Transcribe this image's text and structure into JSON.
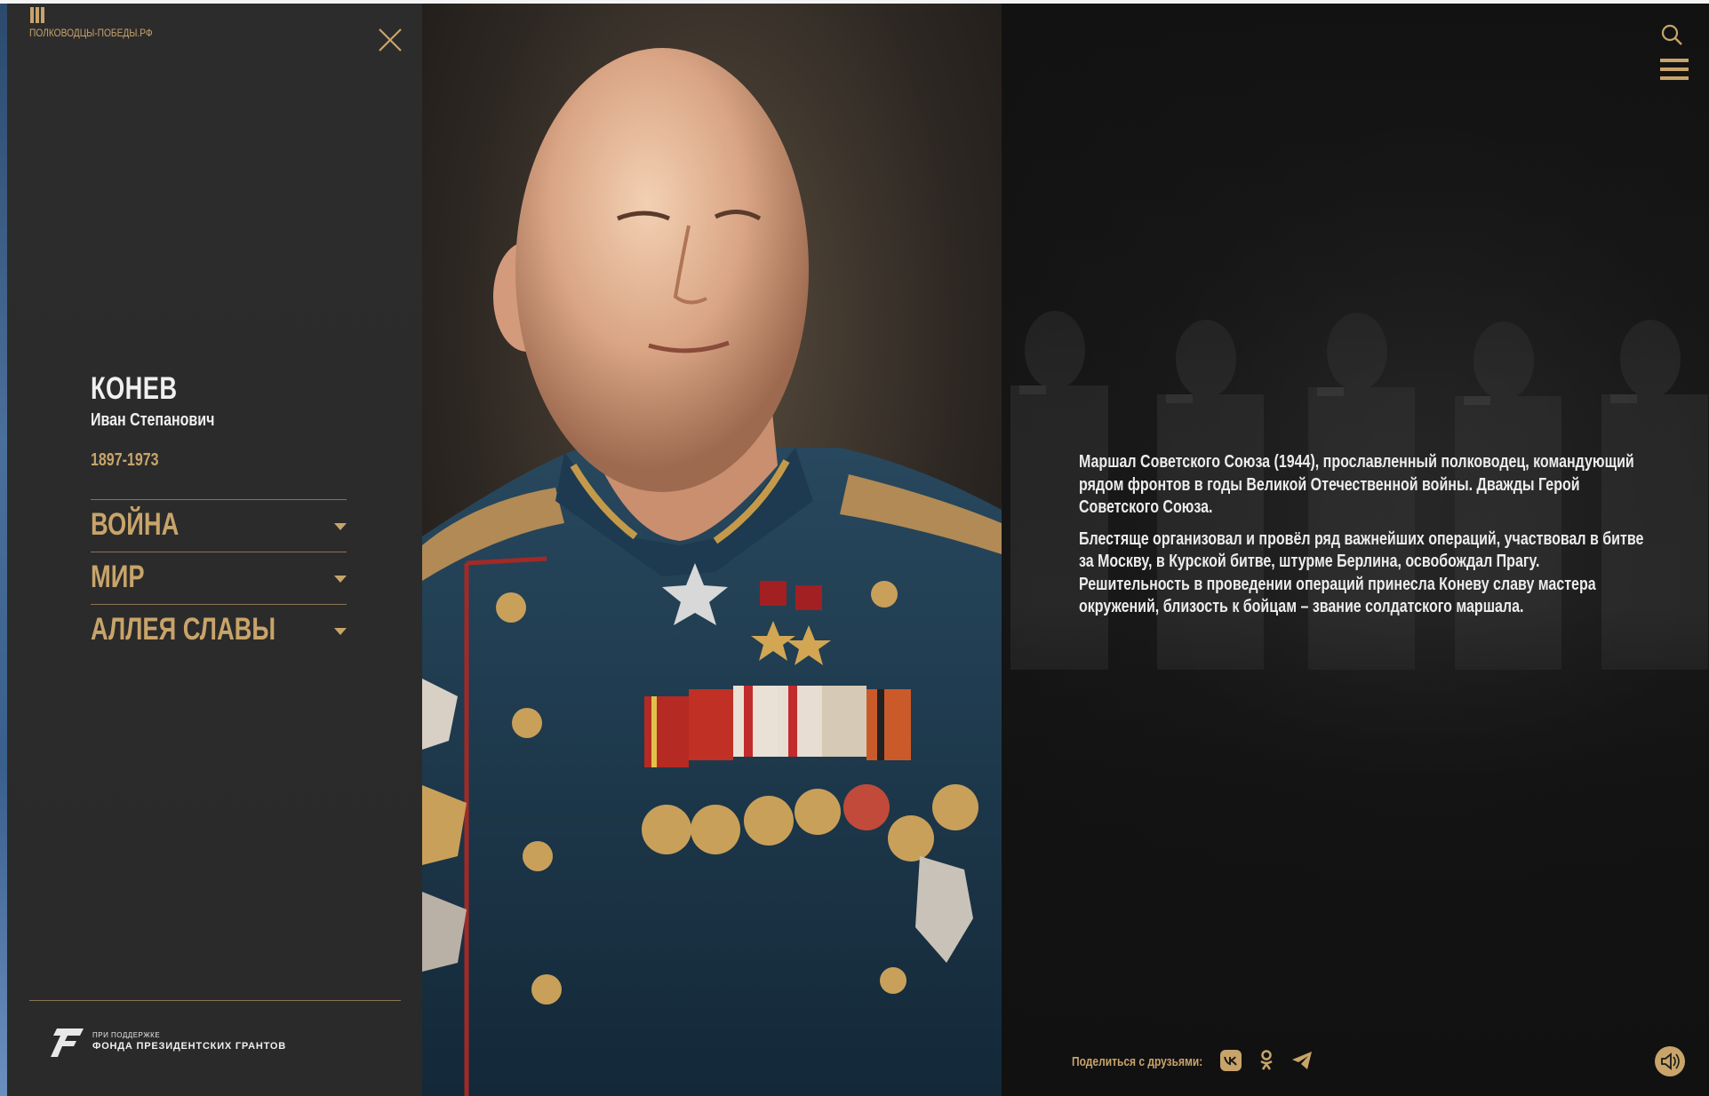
{
  "site": {
    "logo_text": "ПОЛКОВОДЦЫ-ПОБЕДЫ.РФ"
  },
  "person": {
    "surname": "КОНЕВ",
    "given_names": "Иван Степанович",
    "years": "1897-1973"
  },
  "menu": [
    {
      "label": "ВОЙНА"
    },
    {
      "label": "МИР"
    },
    {
      "label": "АЛЛЕЯ СЛАВЫ"
    }
  ],
  "sponsor": {
    "small": "ПРИ ПОДДЕРЖКЕ",
    "big": "ФОНДА ПРЕЗИДЕНТСКИХ ГРАНТОВ"
  },
  "bio": {
    "p1": "Маршал Советского Союза (1944), прославленный полководец, командующий рядом фронтов в годы Великой Отечественной войны. Дважды Герой Советского Союза.",
    "p2": "Блестяще организовал и провёл ряд важнейших операций, участвовал в битве за Москву, в Курской битве, штурме Берлина, освобождал Прагу. Решительность в проведении операций принесла Коневу славу мастера окружений, близость к бойцам – звание солдатского маршала."
  },
  "share": {
    "label": "Поделиться с друзьями:",
    "icons": [
      "vk-icon",
      "odnoklassniki-icon",
      "telegram-icon"
    ]
  },
  "colors": {
    "accent": "#c8a46a",
    "sidebar": "#2b2b2b",
    "text": "#ececec"
  }
}
